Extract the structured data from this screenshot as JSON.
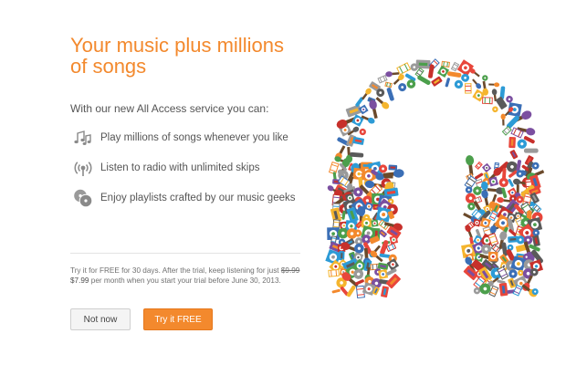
{
  "headline": "Your music plus millions of songs",
  "intro": "With our new All Access service you can:",
  "features": [
    {
      "icon": "music-notes-icon",
      "label": "Play millions of songs whenever you like"
    },
    {
      "icon": "radio-broadcast-icon",
      "label": "Listen to radio with unlimited skips"
    },
    {
      "icon": "records-icon",
      "label": "Enjoy playlists crafted by our music geeks"
    }
  ],
  "offer": {
    "lead": "Try it for FREE for 30 days. After the trial, keep listening for just",
    "old_price": "$9.99",
    "new_price": "$7.99",
    "tail": "per month when you start your trial before June 30, 2013."
  },
  "buttons": {
    "not_now": "Not now",
    "try_free": "Try it FREE"
  },
  "illustration": {
    "icon": "headphones-collage-icon"
  },
  "colors": {
    "accent": "#f3892d",
    "text": "#555555",
    "icon_gray": "#8a8a8a"
  }
}
